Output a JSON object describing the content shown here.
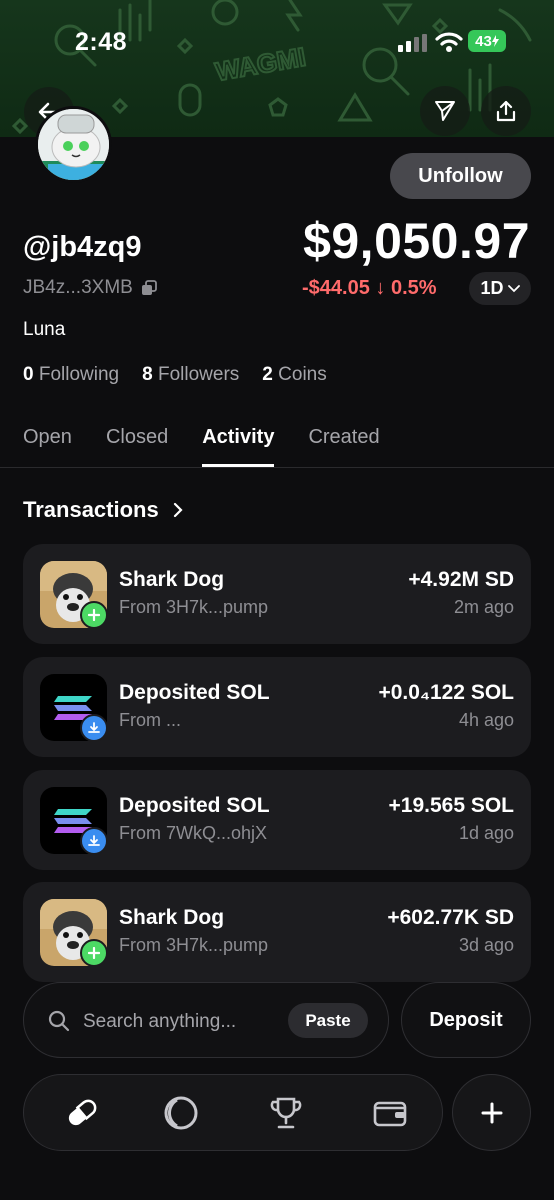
{
  "status_bar": {
    "time": "2:48",
    "battery": "43"
  },
  "banner": {
    "pattern_text": "WAGMI",
    "pattern_color": "#2f5a34"
  },
  "profile": {
    "handle": "@jb4zq9",
    "address": "JB4z...3XMB",
    "name": "Luna",
    "follow_button": "Unfollow",
    "balance": "$9,050.97",
    "change": "-$44.05 ↓ 0.5%",
    "range": "1D",
    "stats": [
      {
        "value": "0",
        "label": "Following"
      },
      {
        "value": "8",
        "label": "Followers"
      },
      {
        "value": "2",
        "label": "Coins"
      }
    ]
  },
  "tabs": [
    {
      "label": "Open"
    },
    {
      "label": "Closed"
    },
    {
      "label": "Activity",
      "active": true
    },
    {
      "label": "Created"
    }
  ],
  "transactions": {
    "title": "Transactions",
    "items": [
      {
        "title": "Shark Dog",
        "sub": "From 3H7k...pump",
        "amount": "+4.92M SD",
        "ago": "2m ago",
        "icon": "shark-dog-token",
        "badge": "plus-icon"
      },
      {
        "title": "Deposited SOL",
        "sub": "From ...",
        "amount": "+0.0₄122 SOL",
        "ago": "4h ago",
        "icon": "solana-token",
        "badge": "download-icon"
      },
      {
        "title": "Deposited SOL",
        "sub": "From 7WkQ...ohjX",
        "amount": "+19.565 SOL",
        "ago": "1d ago",
        "icon": "solana-token",
        "badge": "download-icon"
      },
      {
        "title": "Shark Dog",
        "sub": "From 3H7k...pump",
        "amount": "+602.77K SD",
        "ago": "3d ago",
        "icon": "shark-dog-token",
        "badge": "plus-icon"
      }
    ]
  },
  "search": {
    "placeholder": "Search anything...",
    "paste": "Paste"
  },
  "deposit": "Deposit",
  "colors": {
    "negative": "#ff6b6b",
    "plus_badge": "#4cd964",
    "download_badge": "#3a8df0",
    "battery": "#35c759"
  }
}
